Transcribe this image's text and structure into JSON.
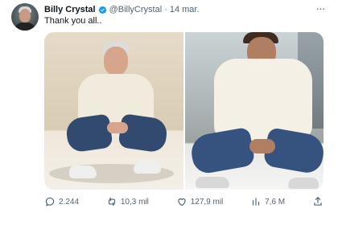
{
  "tweet": {
    "author": {
      "name": "Billy Crystal",
      "handle": "@BillyCrystal",
      "date": "14 mar."
    },
    "text": "Thank you all..",
    "stats": {
      "replies": "2.244",
      "retweets": "10,3 mil",
      "likes": "127,9 mil",
      "views": "7,6 M"
    }
  },
  "colors": {
    "text": "#0f1419",
    "muted": "#536471",
    "verified": "#1d9bf0",
    "background": "#ffffff"
  },
  "icons": {
    "verified": "verified-badge-icon",
    "more": "more-icon",
    "reply": "reply-icon",
    "retweet": "retweet-icon",
    "like": "like-icon",
    "views": "views-icon",
    "share": "share-icon"
  }
}
